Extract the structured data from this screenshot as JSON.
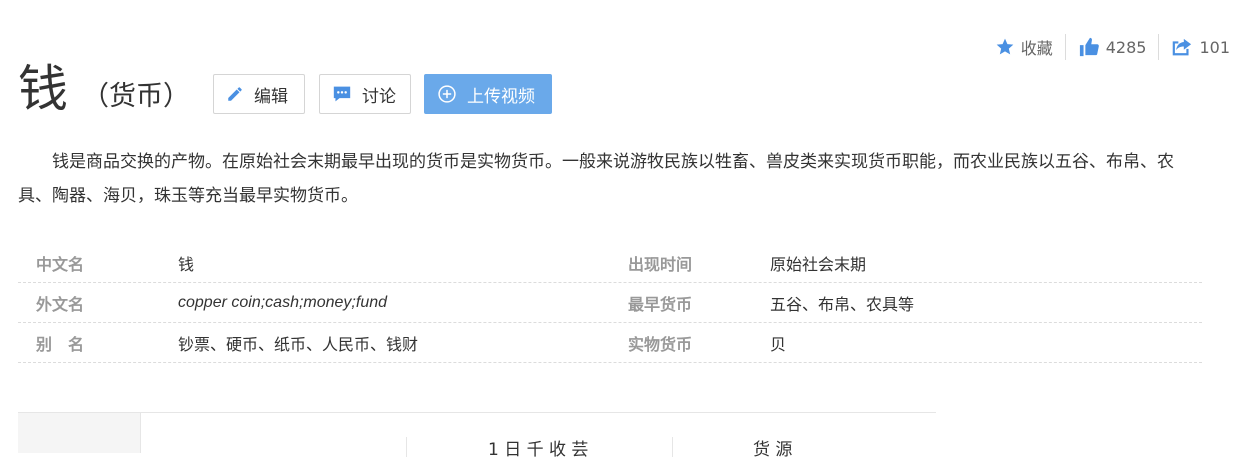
{
  "top_actions": {
    "favorite_label": "收藏",
    "like_count": "4285",
    "share_count": "101"
  },
  "title": {
    "main": "钱",
    "sub": "（货币）"
  },
  "buttons": {
    "edit": "编辑",
    "discuss": "讨论",
    "upload_video": "上传视频"
  },
  "summary": "钱是商品交换的产物。在原始社会末期最早出现的货币是实物货币。一般来说游牧民族以牲畜、兽皮类来实现货币职能，而农业民族以五谷、布帛、农具、陶器、海贝，珠玉等充当最早实物货币。",
  "info": [
    {
      "k1": "中文名",
      "v1": "钱",
      "k2": "出现时间",
      "v2": "原始社会末期"
    },
    {
      "k1": "外文名",
      "v1": "copper coin;cash;money;fund",
      "k2": "最早货币",
      "v2": "五谷、布帛、农具等"
    },
    {
      "k1": "别　名",
      "v1": "钞票、硬币、纸币、人民币、钱财",
      "k2": "实物货币",
      "v2": "贝"
    }
  ],
  "bottom_tabs": [
    "",
    "1 日 千 收 芸",
    "货 源"
  ],
  "colors": {
    "accent_blue": "#4a90e2",
    "video_button": "#6aa9ea"
  }
}
